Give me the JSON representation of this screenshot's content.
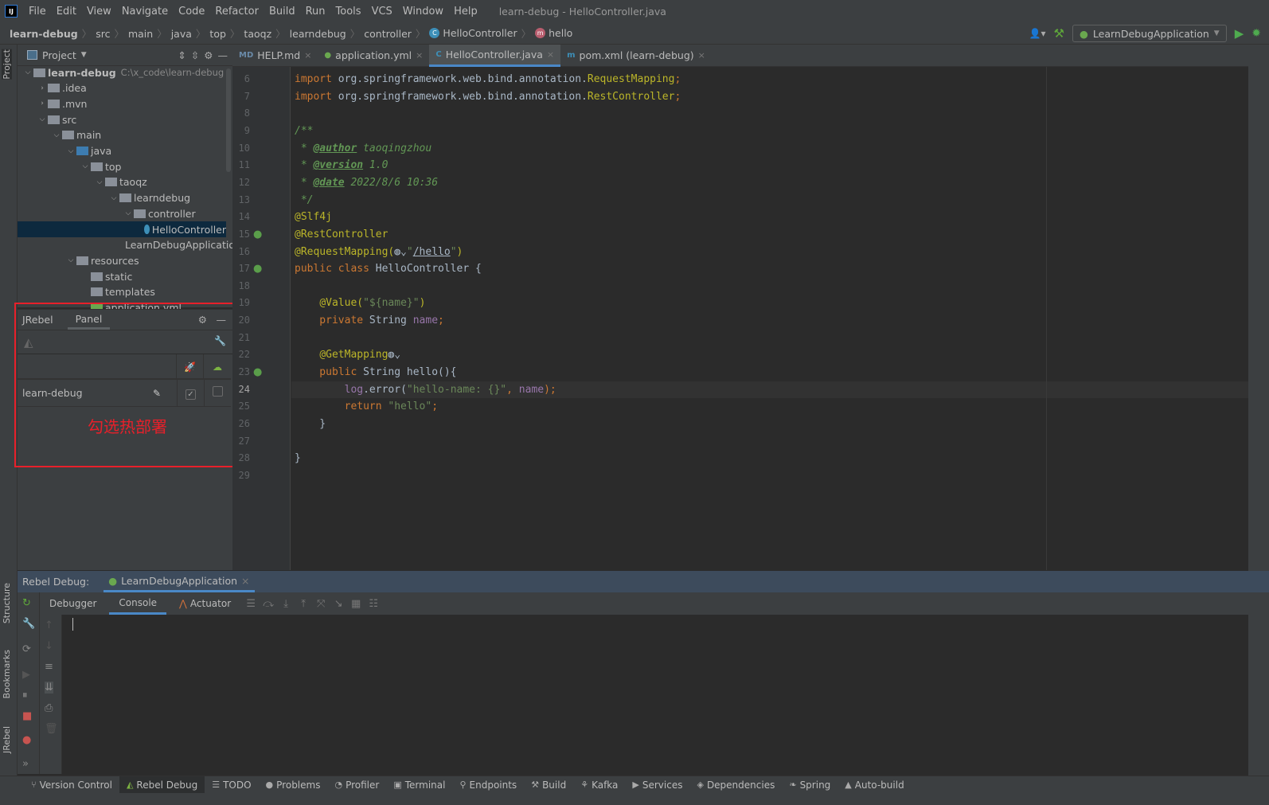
{
  "window": {
    "title": "learn-debug - HelloController.java",
    "logo": "IJ"
  },
  "menu": [
    "File",
    "Edit",
    "View",
    "Navigate",
    "Code",
    "Refactor",
    "Build",
    "Run",
    "Tools",
    "VCS",
    "Window",
    "Help"
  ],
  "breadcrumb": {
    "items": [
      "learn-debug",
      "src",
      "main",
      "java",
      "top",
      "taoqz",
      "learndebug",
      "controller"
    ],
    "class_name": "HelloController",
    "method_name": "hello"
  },
  "toolbar": {
    "run_config": "LearnDebugApplication"
  },
  "left_stripe": {
    "project": "Project",
    "structure": "Structure",
    "bookmarks": "Bookmarks",
    "jrebel": "JRebel"
  },
  "project": {
    "title": "Project",
    "tree": [
      {
        "label": "learn-debug",
        "hint": "C:\\x_code\\learn-debug",
        "depth": 0,
        "fold": "v",
        "icon": "folder",
        "bold": true
      },
      {
        "label": ".idea",
        "depth": 1,
        "fold": ">",
        "icon": "folder"
      },
      {
        "label": ".mvn",
        "depth": 1,
        "fold": ">",
        "icon": "folder"
      },
      {
        "label": "src",
        "depth": 1,
        "fold": "v",
        "icon": "folder"
      },
      {
        "label": "main",
        "depth": 2,
        "fold": "v",
        "icon": "folder"
      },
      {
        "label": "java",
        "depth": 3,
        "fold": "v",
        "icon": "source-folder"
      },
      {
        "label": "top",
        "depth": 4,
        "fold": "v",
        "icon": "package"
      },
      {
        "label": "taoqz",
        "depth": 5,
        "fold": "v",
        "icon": "package"
      },
      {
        "label": "learndebug",
        "depth": 6,
        "fold": "v",
        "icon": "package"
      },
      {
        "label": "controller",
        "depth": 7,
        "fold": "v",
        "icon": "package"
      },
      {
        "label": "HelloController",
        "depth": 8,
        "fold": "",
        "icon": "class",
        "selected": true
      },
      {
        "label": "LearnDebugApplication",
        "depth": 7,
        "fold": "",
        "icon": "spring-class"
      },
      {
        "label": "resources",
        "depth": 3,
        "fold": "v",
        "icon": "resources-folder"
      },
      {
        "label": "static",
        "depth": 4,
        "fold": "",
        "icon": "folder"
      },
      {
        "label": "templates",
        "depth": 4,
        "fold": "",
        "icon": "folder"
      },
      {
        "label": "application.yml",
        "depth": 4,
        "fold": "",
        "icon": "yaml"
      }
    ]
  },
  "jrebel": {
    "tabs": [
      "JRebel",
      "Panel"
    ],
    "active_tab": "Panel",
    "rows": [
      {
        "name": "learn-debug",
        "jrebel_enabled": true,
        "remote_enabled": false
      }
    ],
    "annotation": "勾选热部署"
  },
  "editor": {
    "tabs": [
      {
        "label": "HELP.md",
        "icon": "markdown"
      },
      {
        "label": "application.yml",
        "icon": "spring-yaml"
      },
      {
        "label": "HelloController.java",
        "icon": "class",
        "active": true
      },
      {
        "label": "pom.xml (learn-debug)",
        "icon": "maven"
      }
    ],
    "current_line": 24,
    "lines": [
      {
        "n": 6,
        "t": [
          [
            "import",
            "kw"
          ],
          [
            " org.springframework.web.bind.annotation.",
            "pkg"
          ],
          [
            "RequestMapping",
            "ann"
          ],
          [
            ";",
            "kw"
          ]
        ]
      },
      {
        "n": 7,
        "t": [
          [
            "import",
            "kw"
          ],
          [
            " org.springframework.web.bind.annotation.",
            "pkg"
          ],
          [
            "RestController",
            "ann"
          ],
          [
            ";",
            "kw"
          ]
        ]
      },
      {
        "n": 8,
        "t": []
      },
      {
        "n": 9,
        "t": [
          [
            "/**",
            "doc"
          ]
        ]
      },
      {
        "n": 10,
        "t": [
          [
            " * ",
            "doc"
          ],
          [
            "@author",
            "doctag"
          ],
          [
            " taoqingzhou",
            "doc"
          ]
        ]
      },
      {
        "n": 11,
        "t": [
          [
            " * ",
            "doc"
          ],
          [
            "@version",
            "doctag"
          ],
          [
            " 1.0",
            "doc"
          ]
        ]
      },
      {
        "n": 12,
        "t": [
          [
            " * ",
            "doc"
          ],
          [
            "@date",
            "doctag"
          ],
          [
            " 2022/8/6 10:36",
            "doc"
          ]
        ]
      },
      {
        "n": 13,
        "t": [
          [
            " */",
            "doc"
          ]
        ]
      },
      {
        "n": 14,
        "t": [
          [
            "@Slf4j",
            "ann"
          ]
        ]
      },
      {
        "n": 15,
        "t": [
          [
            "@RestController",
            "ann"
          ]
        ],
        "gutter": "bean"
      },
      {
        "n": 16,
        "t": [
          [
            "@RequestMapping(",
            "ann"
          ],
          [
            "◍⌄",
            "pkg"
          ],
          [
            "\"",
            "str"
          ],
          [
            "/hello",
            "link"
          ],
          [
            "\"",
            "str"
          ],
          [
            ")",
            "ann"
          ]
        ]
      },
      {
        "n": 17,
        "t": [
          [
            "public class ",
            "kw"
          ],
          [
            "HelloController {",
            "pkg"
          ]
        ],
        "gutter": "bean-web"
      },
      {
        "n": 18,
        "t": []
      },
      {
        "n": 19,
        "t": [
          [
            "    ",
            "pkg"
          ],
          [
            "@Value(",
            "ann"
          ],
          [
            "\"${name}\"",
            "str"
          ],
          [
            ")",
            "ann"
          ]
        ]
      },
      {
        "n": 20,
        "t": [
          [
            "    private ",
            "kw"
          ],
          [
            "String ",
            "pkg"
          ],
          [
            "name",
            "field"
          ],
          [
            ";",
            "kw"
          ]
        ]
      },
      {
        "n": 21,
        "t": []
      },
      {
        "n": 22,
        "t": [
          [
            "    ",
            "pkg"
          ],
          [
            "@GetMapping",
            "ann"
          ],
          [
            "◍⌄",
            "pkg"
          ]
        ]
      },
      {
        "n": 23,
        "t": [
          [
            "    public ",
            "kw"
          ],
          [
            "String ",
            "pkg"
          ],
          [
            "hello",
            "pkg"
          ],
          [
            "(){",
            "pkg"
          ]
        ],
        "gutter": "web"
      },
      {
        "n": 24,
        "t": [
          [
            "        ",
            "pkg"
          ],
          [
            "log",
            "field"
          ],
          [
            ".error(",
            "pkg"
          ],
          [
            "\"hello-name: {}\"",
            "str"
          ],
          [
            ", ",
            "kw"
          ],
          [
            "name",
            "field"
          ],
          [
            ");",
            "kw"
          ]
        ]
      },
      {
        "n": 25,
        "t": [
          [
            "        return ",
            "kw"
          ],
          [
            "\"hello\"",
            "str"
          ],
          [
            ";",
            "kw"
          ]
        ]
      },
      {
        "n": 26,
        "t": [
          [
            "    }",
            "pkg"
          ]
        ]
      },
      {
        "n": 27,
        "t": []
      },
      {
        "n": 28,
        "t": [
          [
            "}",
            "pkg"
          ]
        ]
      },
      {
        "n": 29,
        "t": []
      }
    ]
  },
  "debug": {
    "label": "Rebel Debug:",
    "session": "LearnDebugApplication",
    "tabs": [
      "Debugger",
      "Console",
      "Actuator"
    ],
    "active_tab": "Console"
  },
  "statusbar": [
    {
      "label": "Version Control",
      "icon": "vcs"
    },
    {
      "label": "Rebel Debug",
      "icon": "jrebel",
      "active": true
    },
    {
      "label": "TODO",
      "icon": "list"
    },
    {
      "label": "Problems",
      "icon": "problems"
    },
    {
      "label": "Profiler",
      "icon": "profiler"
    },
    {
      "label": "Terminal",
      "icon": "terminal"
    },
    {
      "label": "Endpoints",
      "icon": "endpoints"
    },
    {
      "label": "Build",
      "icon": "hammer"
    },
    {
      "label": "Kafka",
      "icon": "kafka"
    },
    {
      "label": "Services",
      "icon": "services"
    },
    {
      "label": "Dependencies",
      "icon": "dependencies"
    },
    {
      "label": "Spring",
      "icon": "spring"
    },
    {
      "label": "Auto-build",
      "icon": "warning"
    }
  ],
  "colors": {
    "accent": "#4a88c7",
    "selection": "#0d293e",
    "annotation_box": "#e8202a",
    "spring_green": "#6aa84f"
  }
}
